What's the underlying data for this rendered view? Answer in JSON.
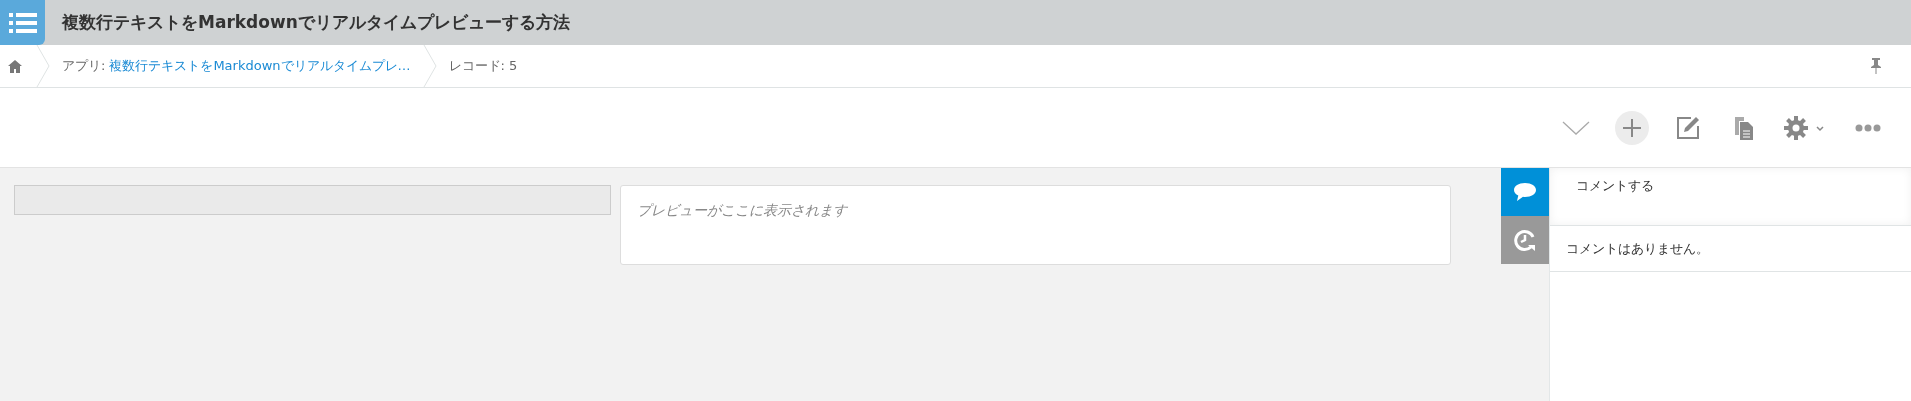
{
  "app_title": "複数行テキストをMarkdownでリアルタイムプレビューする方法",
  "breadcrumb": {
    "app_label": "アプリ:",
    "app_link": "複数行テキストをMarkdownでリアルタイムプレ…",
    "record": "レコード: 5"
  },
  "preview": {
    "placeholder": "プレビューがここに表示されます"
  },
  "side_tabs": [
    {
      "kind": "comments",
      "selected": true
    },
    {
      "kind": "history",
      "selected": false
    }
  ],
  "comments": {
    "placeholder": "コメントする",
    "empty_message": "コメントはありません。"
  }
}
